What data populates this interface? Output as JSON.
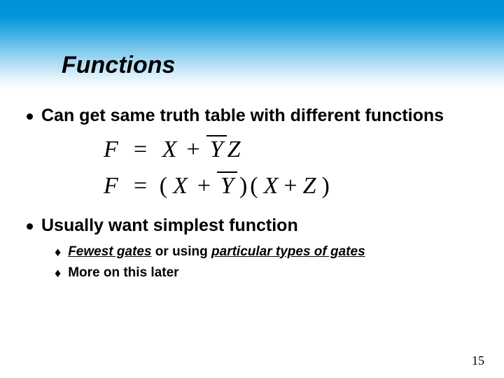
{
  "slide": {
    "title": "Functions",
    "page_number": "15"
  },
  "bullets": {
    "b1": "Can get same truth table with different functions",
    "b2": "Usually want simplest function",
    "sub1_pre": "",
    "sub1_u1": "Fewest gates",
    "sub1_mid": " or using ",
    "sub1_u2": "particular types of gates",
    "sub2": "More on this later"
  },
  "equations": {
    "lhs": "F",
    "eq": "=",
    "plus": "+",
    "X": "X",
    "Y": "Y",
    "Z": "Z",
    "lp": "(",
    "rp": ")"
  }
}
